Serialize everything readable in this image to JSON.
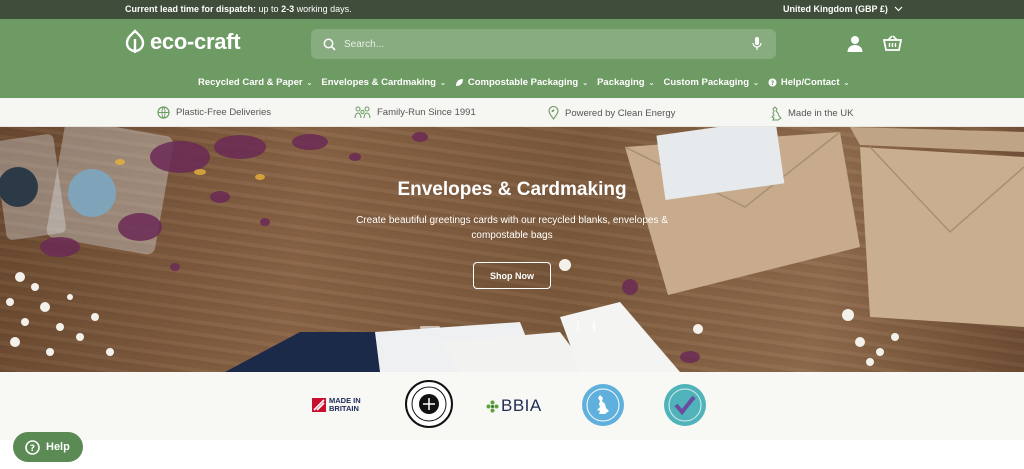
{
  "topbar": {
    "lead_bold": "Current lead time for dispatch:",
    "lead_rest": " up to ",
    "lead_days": "2-3",
    "lead_end": " working days.",
    "region": "United Kingdom (GBP £)"
  },
  "header": {
    "logo_text": "eco-craft",
    "search_placeholder": "Search..."
  },
  "nav": {
    "items": [
      {
        "label": "Recycled Card & Paper"
      },
      {
        "label": "Envelopes & Cardmaking"
      },
      {
        "label": "Compostable Packaging"
      },
      {
        "label": "Packaging"
      },
      {
        "label": "Custom Packaging"
      },
      {
        "label": "Help/Contact"
      }
    ]
  },
  "usp": {
    "items": [
      {
        "label": "Plastic-Free Deliveries",
        "icon": "globe-leaf-icon"
      },
      {
        "label": "Family-Run Since 1991",
        "icon": "family-icon"
      },
      {
        "label": "Powered by Clean Energy",
        "icon": "pin-leaf-icon"
      },
      {
        "label": "Made in the UK",
        "icon": "uk-map-icon"
      }
    ]
  },
  "hero": {
    "title": "Envelopes & Cardmaking",
    "subtitle": "Create beautiful greetings cards with our recycled blanks, envelopes & compostable bags",
    "button": "Shop Now"
  },
  "badges": {
    "made_in_britain": "MADE IN BRITAIN",
    "bbia": "BBIA"
  },
  "help": {
    "label": "Help"
  },
  "colors": {
    "brand_green": "#6e9a64",
    "topbar": "#3f4d3a",
    "help_green": "#5c8a55"
  }
}
